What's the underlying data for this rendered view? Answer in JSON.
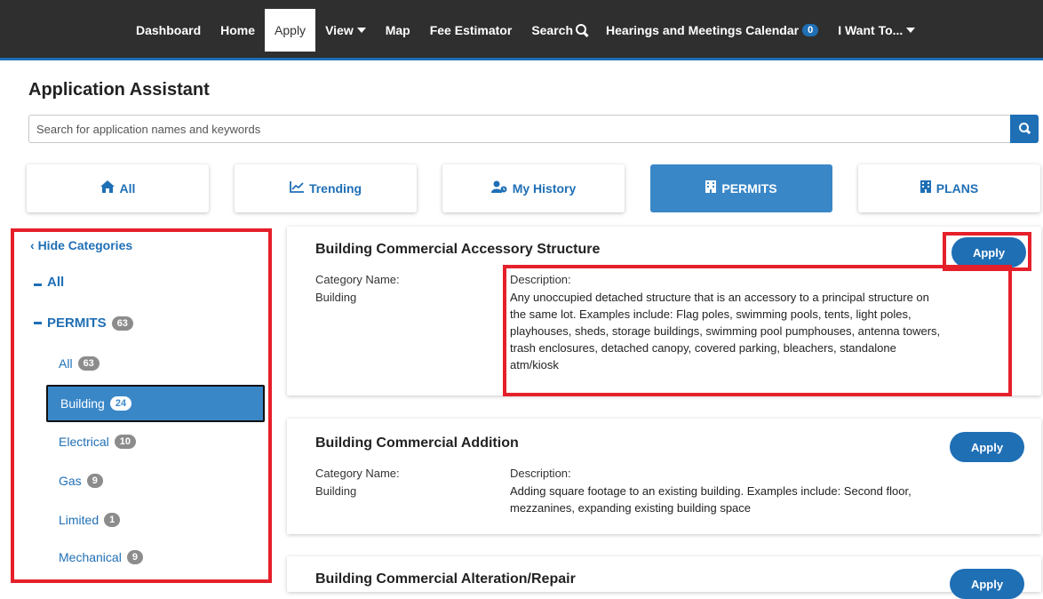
{
  "nav": {
    "items": [
      {
        "label": "Dashboard"
      },
      {
        "label": "Home"
      },
      {
        "label": "Apply"
      },
      {
        "label": "View"
      },
      {
        "label": "Map"
      },
      {
        "label": "Fee Estimator"
      },
      {
        "label": "Search"
      },
      {
        "label": "Hearings and Meetings Calendar",
        "badge": "0"
      },
      {
        "label": "I Want To..."
      }
    ],
    "active": "Apply"
  },
  "page": {
    "title": "Application Assistant",
    "search_placeholder": "Search for application names and keywords",
    "search_value": ""
  },
  "tabs": [
    {
      "label": "All",
      "icon": "home-icon"
    },
    {
      "label": "Trending",
      "icon": "line-chart-icon"
    },
    {
      "label": "My History",
      "icon": "user-history-icon"
    },
    {
      "label": "PERMITS",
      "icon": "building-icon"
    },
    {
      "label": "PLANS",
      "icon": "building-icon"
    }
  ],
  "active_tab": "PERMITS",
  "sidebar": {
    "hide_label": "Hide Categories",
    "all_label": "All",
    "permits": {
      "label": "PERMITS",
      "count": "63"
    },
    "items": [
      {
        "label": "All",
        "count": "63"
      },
      {
        "label": "Building",
        "count": "24"
      },
      {
        "label": "Electrical",
        "count": "10"
      },
      {
        "label": "Gas",
        "count": "9"
      },
      {
        "label": "Limited",
        "count": "1"
      },
      {
        "label": "Mechanical",
        "count": "9"
      }
    ],
    "selected": "Building"
  },
  "results": [
    {
      "title": "Building Commercial Accessory Structure",
      "apply_label": "Apply",
      "category_label": "Category Name:",
      "category": "Building",
      "description_label": "Description:",
      "description_lines": [
        "Any unoccupied detached structure that is an accessory to a principal structure on",
        "the same lot. Examples include: Flag poles, swimming pools, tents, light poles,",
        "playhouses, sheds, storage buildings, swimming pool pumphouses, antenna towers,",
        "trash enclosures, detached canopy, covered parking, bleachers, standalone",
        "atm/kiosk"
      ]
    },
    {
      "title": "Building Commercial Addition",
      "apply_label": "Apply",
      "category_label": "Category Name:",
      "category": "Building",
      "description_label": "Description:",
      "description_lines": [
        "Adding square footage to an existing building. Examples include: Second floor,",
        "mezzanines, expanding existing building space"
      ]
    },
    {
      "title": "Building Commercial Alteration/Repair",
      "apply_label": "Apply"
    }
  ],
  "colors": {
    "accent": "#1f6fb5",
    "active_tab": "#3a87c8",
    "nav_bg": "#2f2f2f",
    "highlight": "#e5202a",
    "badge": "#8c8c8c"
  }
}
